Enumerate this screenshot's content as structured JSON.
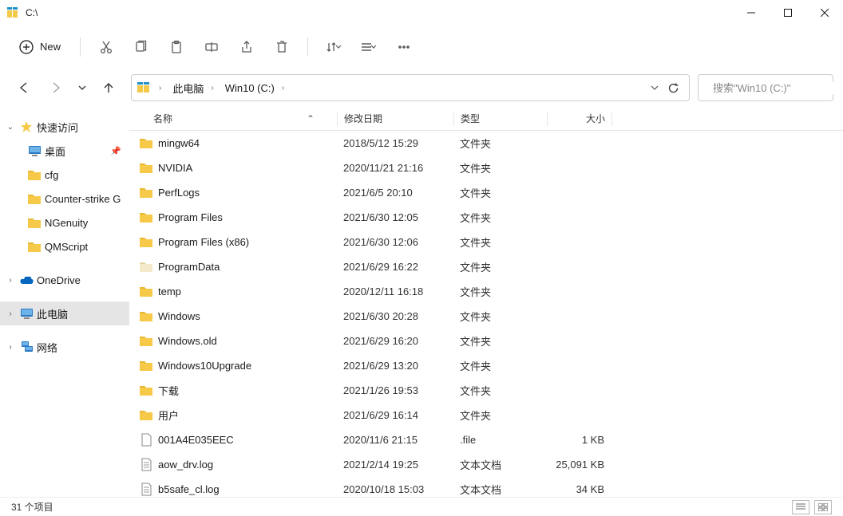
{
  "window": {
    "title": "C:\\"
  },
  "toolbar": {
    "new_label": "New"
  },
  "breadcrumb": {
    "root": "此电脑",
    "drive": "Win10 (C:)"
  },
  "search": {
    "placeholder": "搜索\"Win10 (C:)\""
  },
  "sidebar": {
    "quick": "快速访问",
    "items": [
      {
        "label": "桌面",
        "pinned": true,
        "icon": "desktop"
      },
      {
        "label": "cfg",
        "icon": "folder"
      },
      {
        "label": "Counter-strike  G",
        "icon": "folder"
      },
      {
        "label": "NGenuity",
        "icon": "folder"
      },
      {
        "label": "QMScript",
        "icon": "folder"
      }
    ],
    "onedrive": "OneDrive",
    "thispc": "此电脑",
    "network": "网络"
  },
  "columns": {
    "name": "名称",
    "date": "修改日期",
    "type": "类型",
    "size": "大小"
  },
  "rows": [
    {
      "name": "mingw64",
      "date": "2018/5/12 15:29",
      "type": "文件夹",
      "size": "",
      "icon": "folder"
    },
    {
      "name": "NVIDIA",
      "date": "2020/11/21 21:16",
      "type": "文件夹",
      "size": "",
      "icon": "folder"
    },
    {
      "name": "PerfLogs",
      "date": "2021/6/5 20:10",
      "type": "文件夹",
      "size": "",
      "icon": "folder"
    },
    {
      "name": "Program Files",
      "date": "2021/6/30 12:05",
      "type": "文件夹",
      "size": "",
      "icon": "folder"
    },
    {
      "name": "Program Files (x86)",
      "date": "2021/6/30 12:06",
      "type": "文件夹",
      "size": "",
      "icon": "folder"
    },
    {
      "name": "ProgramData",
      "date": "2021/6/29 16:22",
      "type": "文件夹",
      "size": "",
      "icon": "folder-light"
    },
    {
      "name": "temp",
      "date": "2020/12/11 16:18",
      "type": "文件夹",
      "size": "",
      "icon": "folder"
    },
    {
      "name": "Windows",
      "date": "2021/6/30 20:28",
      "type": "文件夹",
      "size": "",
      "icon": "folder"
    },
    {
      "name": "Windows.old",
      "date": "2021/6/29 16:20",
      "type": "文件夹",
      "size": "",
      "icon": "folder"
    },
    {
      "name": "Windows10Upgrade",
      "date": "2021/6/29 13:20",
      "type": "文件夹",
      "size": "",
      "icon": "folder"
    },
    {
      "name": "下载",
      "date": "2021/1/26 19:53",
      "type": "文件夹",
      "size": "",
      "icon": "folder"
    },
    {
      "name": "用户",
      "date": "2021/6/29 16:14",
      "type": "文件夹",
      "size": "",
      "icon": "folder"
    },
    {
      "name": "001A4E035EEC",
      "date": "2020/11/6 21:15",
      "type": ".file",
      "size": "1 KB",
      "icon": "file"
    },
    {
      "name": "aow_drv.log",
      "date": "2021/2/14 19:25",
      "type": "文本文档",
      "size": "25,091 KB",
      "icon": "text"
    },
    {
      "name": "b5safe_cl.log",
      "date": "2020/10/18 15:03",
      "type": "文本文档",
      "size": "34 KB",
      "icon": "text"
    }
  ],
  "status": {
    "count": "31 个项目"
  }
}
